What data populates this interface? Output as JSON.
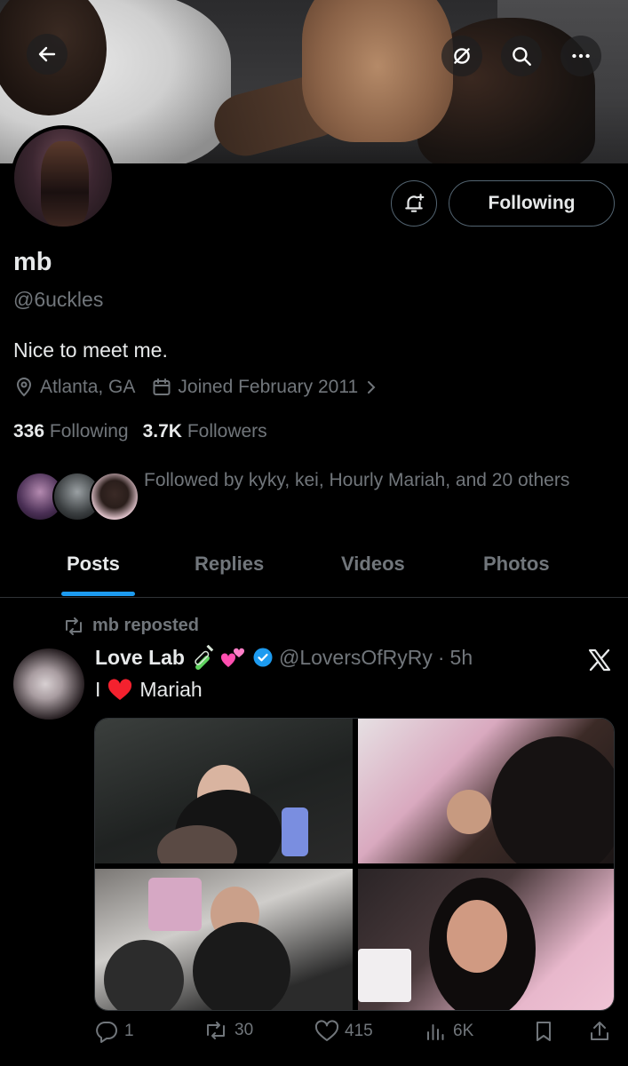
{
  "profile": {
    "name": "mb",
    "handle": "@6uckles",
    "bio": "Nice to meet me.",
    "location": "Atlanta, GA",
    "joined": "Joined February 2011",
    "following_count": "336",
    "following_label": "Following",
    "followers_count": "3.7K",
    "followers_label": "Followers",
    "followed_by": "Followed by kyky, kei, Hourly Mariah, and 20 others",
    "follow_button_label": "Following"
  },
  "tabs": [
    {
      "label": "Posts",
      "active": true
    },
    {
      "label": "Replies",
      "active": false
    },
    {
      "label": "Videos",
      "active": false
    },
    {
      "label": "Photos",
      "active": false
    }
  ],
  "post": {
    "repost_label": "mb reposted",
    "display_name": "Love Lab",
    "handle": "@LoversOfRyRy",
    "time": "5h",
    "text_before": "I",
    "text_after": "Mariah",
    "replies": "1",
    "reposts": "30",
    "likes": "415",
    "views": "6K"
  },
  "colors": {
    "accent": "#1d9bf0",
    "muted": "#71767b",
    "heart": "#f4212e"
  },
  "icons": [
    "back-arrow-icon",
    "fallback-hide-icon",
    "search-icon",
    "more-icon",
    "bell-plus-icon",
    "location-icon",
    "calendar-icon",
    "chevron-right-icon",
    "repost-icon",
    "verified-icon",
    "x-logo-icon",
    "reply-icon",
    "like-icon",
    "views-icon",
    "bookmark-icon",
    "share-icon"
  ]
}
